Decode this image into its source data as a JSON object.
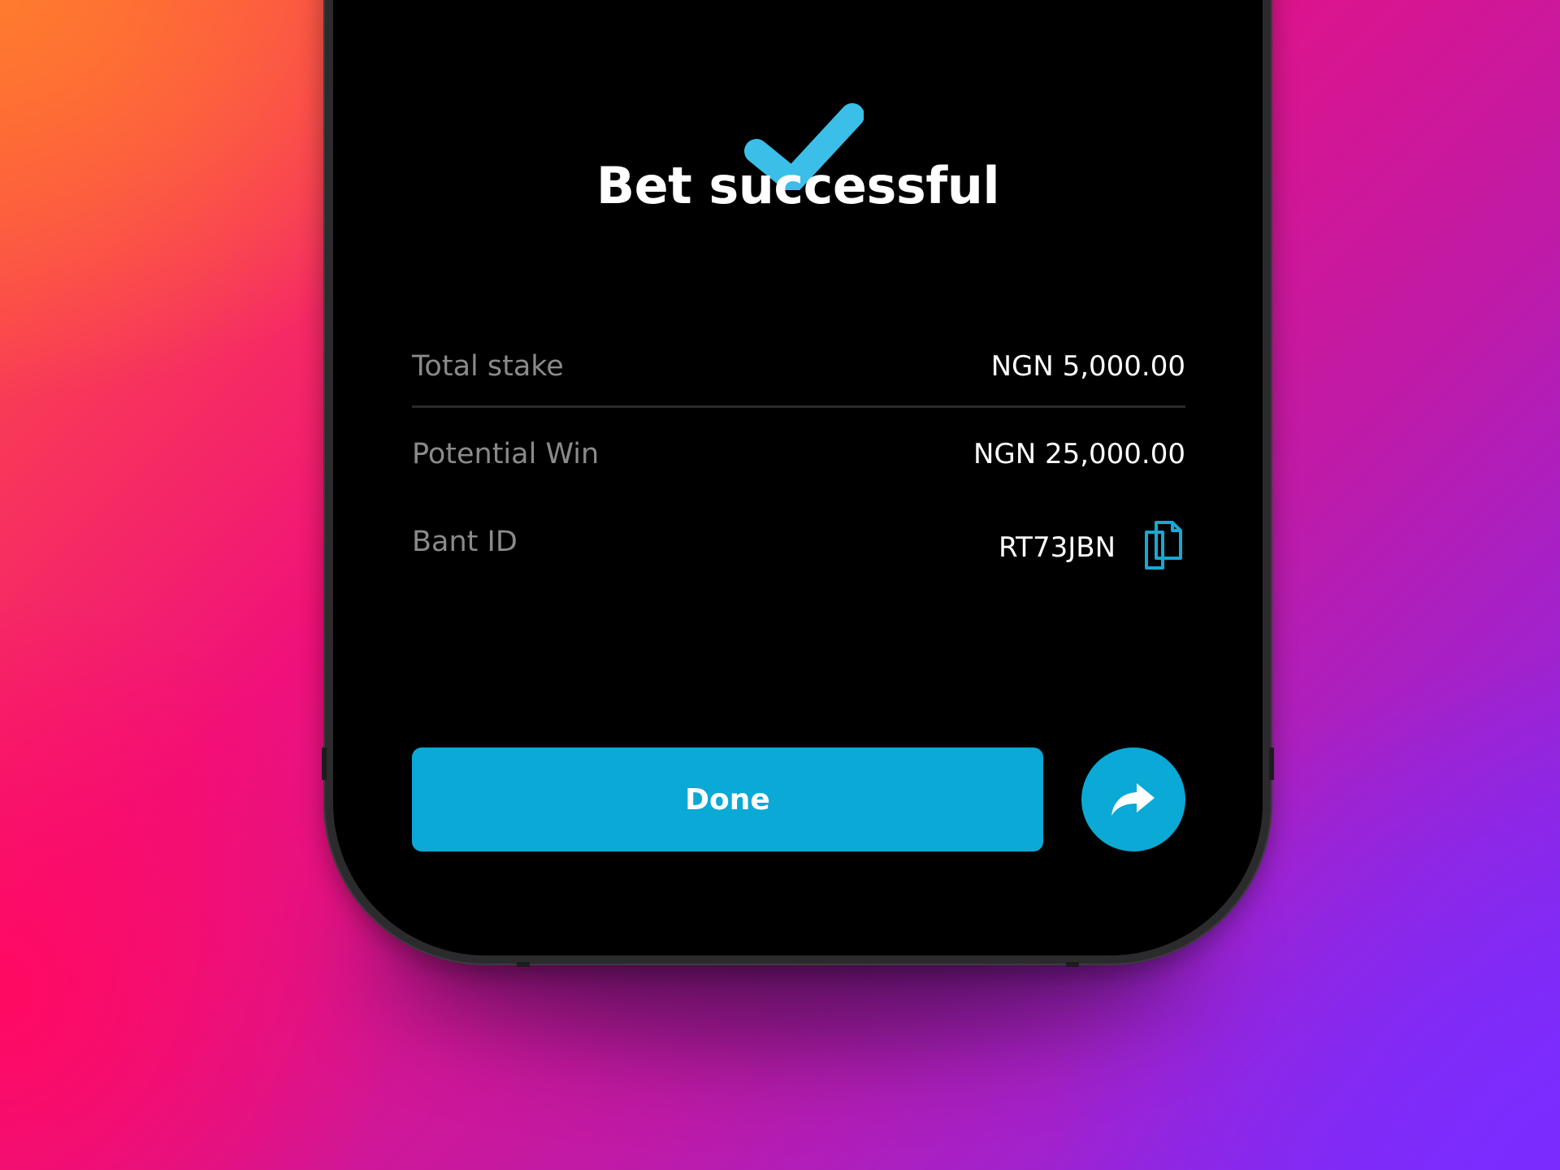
{
  "screen": {
    "title": "Bet successful",
    "status_icon": "checkmark-icon"
  },
  "summary": {
    "rows": [
      {
        "label": "Total stake",
        "value": "NGN 5,000.00"
      },
      {
        "label": "Potential Win",
        "value": "NGN 25,000.00"
      },
      {
        "label": "Bant ID",
        "value": "RT73JBN",
        "action_icon": "copy-icon"
      }
    ]
  },
  "actions": {
    "done_label": "Done",
    "share_icon": "share-arrow-icon"
  },
  "colors": {
    "accent": "#0aa9d6",
    "check": "#3bbfe8",
    "screen_background": "#000000",
    "label_text": "#8a8a8a",
    "value_text": "#ffffff"
  }
}
